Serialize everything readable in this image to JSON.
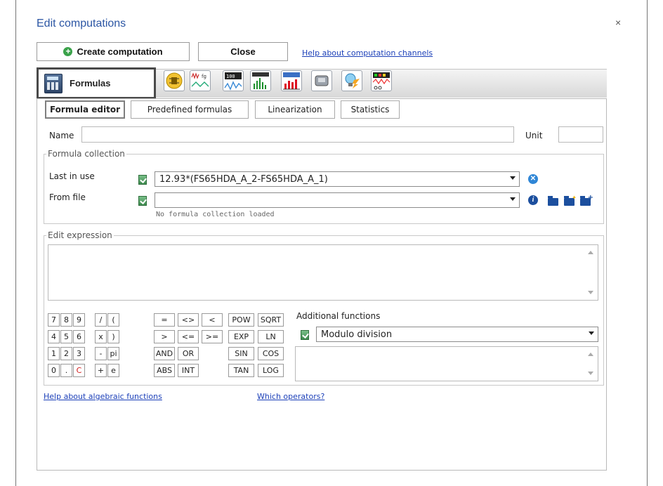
{
  "dialog": {
    "title": "Edit computations",
    "close_glyph": "×"
  },
  "toolbar": {
    "create_label": "Create computation",
    "close_label": "Close",
    "help_link": "Help about computation channels"
  },
  "main_tabs": {
    "active_label": "Formulas",
    "icons": [
      "formulas-calculator-icon",
      "wiring-icon",
      "signal-fg-icon",
      "digital-display-icon",
      "bar-graph-icon",
      "bar-level-icon",
      "chart-red-icon",
      "cartridge-icon",
      "idea-bulb-icon",
      "oscilloscope-icon"
    ]
  },
  "sub_tabs": [
    "Formula editor",
    "Predefined formulas",
    "Linearization",
    "Statistics"
  ],
  "fields": {
    "name_label": "Name",
    "name_value": "",
    "unit_label": "Unit",
    "unit_value": ""
  },
  "collection": {
    "legend": "Formula collection",
    "last_in_use_label": "Last in use",
    "last_in_use_value": "12.93*(FS65HDA_A_2-FS65HDA_A_1)",
    "from_file_label": "From file",
    "from_file_value": "",
    "status": "No formula collection loaded",
    "clear_glyph": "✕",
    "info_glyph": "i"
  },
  "expression": {
    "legend": "Edit expression",
    "value": ""
  },
  "keypad": {
    "rows": [
      [
        "7",
        "8",
        "9",
        "/",
        "(",
        "=",
        "<>",
        "<",
        "POW",
        "SQRT"
      ],
      [
        "4",
        "5",
        "6",
        "x",
        ")",
        ">",
        "<=",
        ">=",
        "EXP",
        "LN"
      ],
      [
        "1",
        "2",
        "3",
        "-",
        "pi",
        "AND",
        "OR",
        "SIN",
        "COS"
      ],
      [
        "0",
        ".",
        "C",
        "+",
        "e",
        "ABS",
        "INT",
        "TAN",
        "LOG"
      ]
    ]
  },
  "additional": {
    "label": "Additional functions",
    "selected": "Modulo division",
    "description": ""
  },
  "links": {
    "algebraic": "Help about algebraic functions",
    "operators": "Which operators?"
  },
  "colors": {
    "title": "#2c56a4",
    "link": "#1b3fb8",
    "active_border": "#4a4a4a",
    "clear_red": "#d21c1c"
  }
}
